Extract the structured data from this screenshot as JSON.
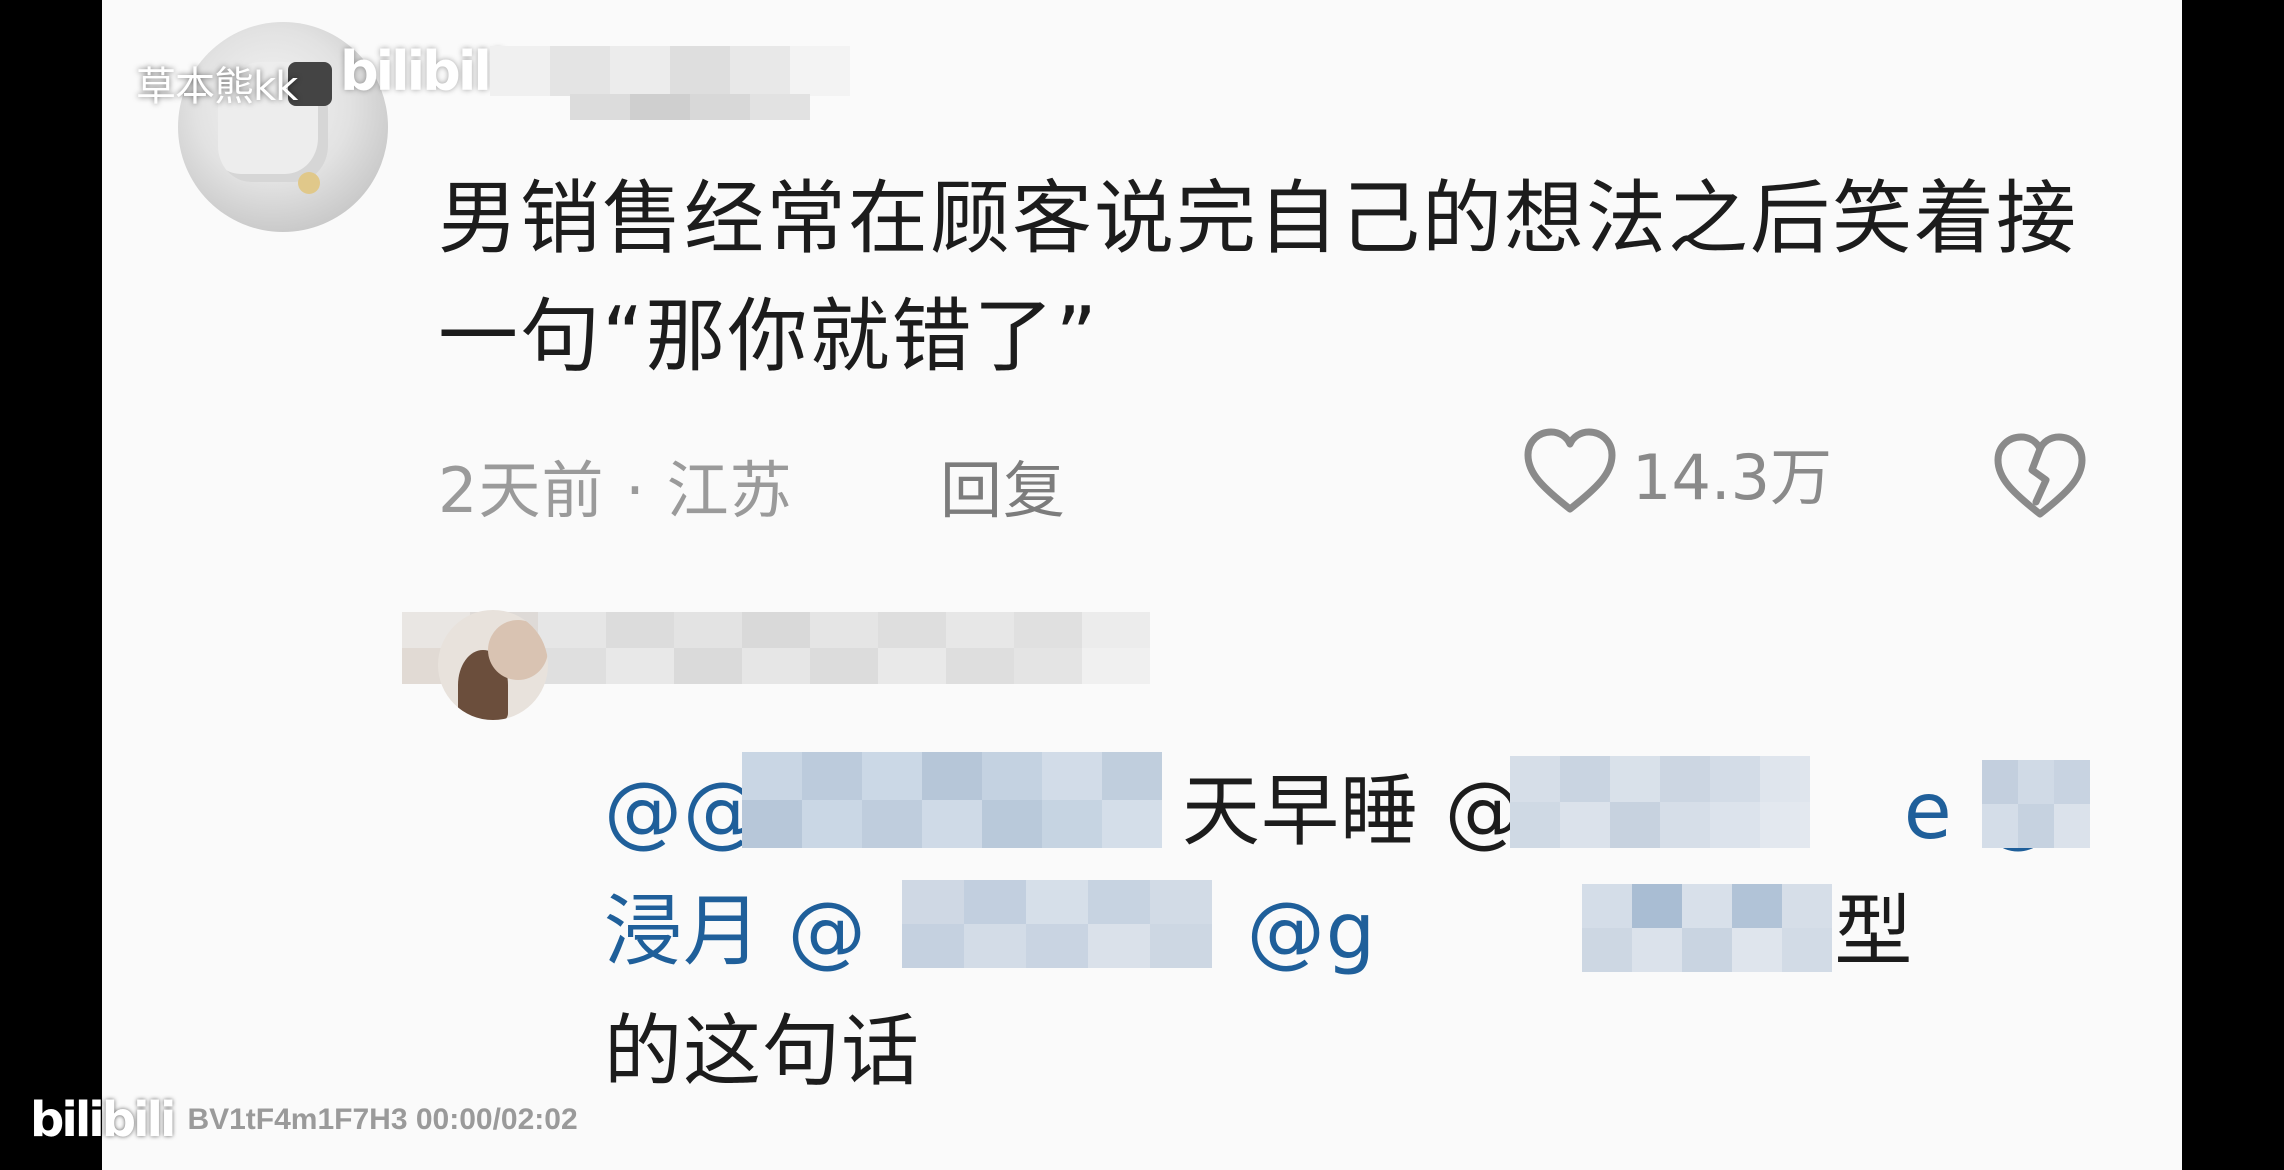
{
  "watermark": {
    "uploader": "草本熊kk",
    "logo": "bilibili",
    "video_id_time": "BV1tF4m1F7H3 00:00/02:02"
  },
  "comment": {
    "text": "男销售经常在顾客说完自己的想法之后笑着接一句“那你就错了”",
    "time_location": "2天前 · 江苏",
    "reply_label": "回复",
    "like_count": "14.3万"
  },
  "reply": {
    "mention_prefix": "@@",
    "mention_fragment_1": "天早睡 @",
    "mention_fragment_2": "e @",
    "mention_fragment_3": "浸月 @",
    "mention_fragment_4": "@g",
    "text_end_1": "好典型",
    "text_end_2": "的这句话"
  },
  "colors": {
    "background": "#fafafa",
    "text": "#1c1c1c",
    "meta": "#9a9a9a",
    "mention": "#1f5f9a"
  }
}
